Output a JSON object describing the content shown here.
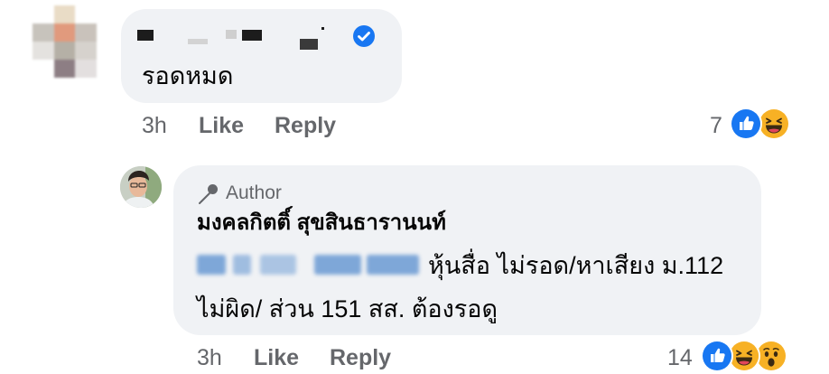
{
  "comment": {
    "text": "รอดหมด",
    "time": "3h",
    "like_label": "Like",
    "reply_label": "Reply",
    "reaction_count": "7",
    "reactions": [
      "like-icon",
      "haha-icon"
    ]
  },
  "reply": {
    "author_badge": "Author",
    "author_name": "มงคลกิตติ์ สุขสินธารานนท์",
    "text_line_1": "หุ้นสื่อ ไม่รอด/หาเสียง ม.112",
    "text_line_2": "ไม่ผิด/ ส่วน 151 สส. ต้องรอดู",
    "time": "3h",
    "like_label": "Like",
    "reply_label": "Reply",
    "reaction_count": "14",
    "reactions": [
      "like-icon",
      "haha-icon",
      "wow-icon"
    ]
  },
  "colors": {
    "bubble": "#f0f2f5",
    "secondary_text": "#65676b",
    "brand_blue": "#1877f2",
    "reaction_yellow": "#f7b125"
  }
}
